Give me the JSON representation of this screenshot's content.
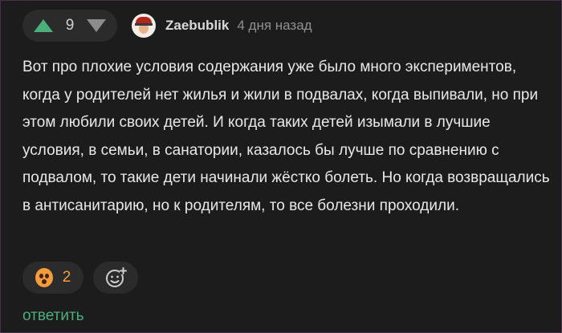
{
  "vote": {
    "score": "9"
  },
  "author": {
    "username": "Zaebublik",
    "time": "4 дня назад"
  },
  "comment": {
    "text": "Вот про плохие условия содержания уже было много экспериментов, когда у родителей нет жилья и жили в подвалах, когда выпивали, но при этом любили своих детей. И когда таких детей изымали в лучшие условия, в семьи, в санатории, казалось бы лучше по сравнению с подвалом, то такие дети начинали жёстко болеть. Но когда возвращались в антисанитарию, но к родителям, то все болезни проходили."
  },
  "reactions": {
    "count": "2",
    "emoji_icon": "scared-face-icon"
  },
  "reply_label": "ответить",
  "colors": {
    "accent": "#4caf7a",
    "reaction": "#f59b3b",
    "background": "#1c1c1c"
  }
}
